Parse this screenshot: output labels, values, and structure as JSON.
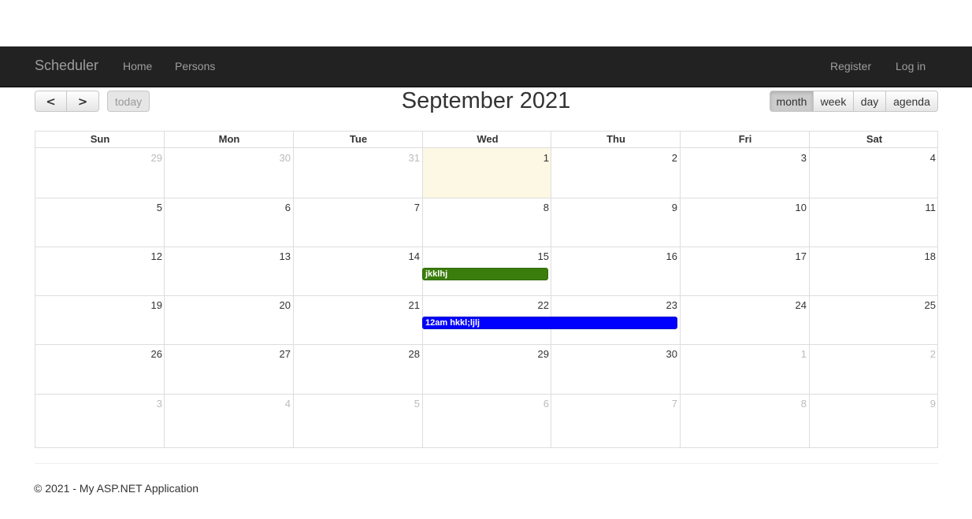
{
  "navbar": {
    "brand": "Scheduler",
    "links": [
      "Home",
      "Persons"
    ],
    "right_links": [
      "Register",
      "Log in"
    ],
    "background": "#222222"
  },
  "toolbar": {
    "prev_icon": "chevron-left-icon",
    "next_icon": "chevron-right-icon",
    "prev_glyph": "<",
    "next_glyph": ">",
    "today_label": "today",
    "title": "September 2021",
    "views": [
      "month",
      "week",
      "day",
      "agenda"
    ],
    "active_view": "month"
  },
  "calendar": {
    "weekdays": [
      "Sun",
      "Mon",
      "Tue",
      "Wed",
      "Thu",
      "Fri",
      "Sat"
    ],
    "weeks": [
      [
        "29",
        "30",
        "31",
        "1",
        "2",
        "3",
        "4"
      ],
      [
        "5",
        "6",
        "7",
        "8",
        "9",
        "10",
        "11"
      ],
      [
        "12",
        "13",
        "14",
        "15",
        "16",
        "17",
        "18"
      ],
      [
        "19",
        "20",
        "21",
        "22",
        "23",
        "24",
        "25"
      ],
      [
        "26",
        "27",
        "28",
        "29",
        "30",
        "1",
        "2"
      ],
      [
        "3",
        "4",
        "5",
        "6",
        "7",
        "8",
        "9"
      ]
    ],
    "today_color": "#fcf8e3",
    "events": [
      {
        "text": "jkklhj",
        "color": "#3a7d0c"
      },
      {
        "text": "12am hkkl;ljlj",
        "color": "#0000ff"
      }
    ]
  },
  "footer": {
    "text": "© 2021 - My ASP.NET Application"
  }
}
